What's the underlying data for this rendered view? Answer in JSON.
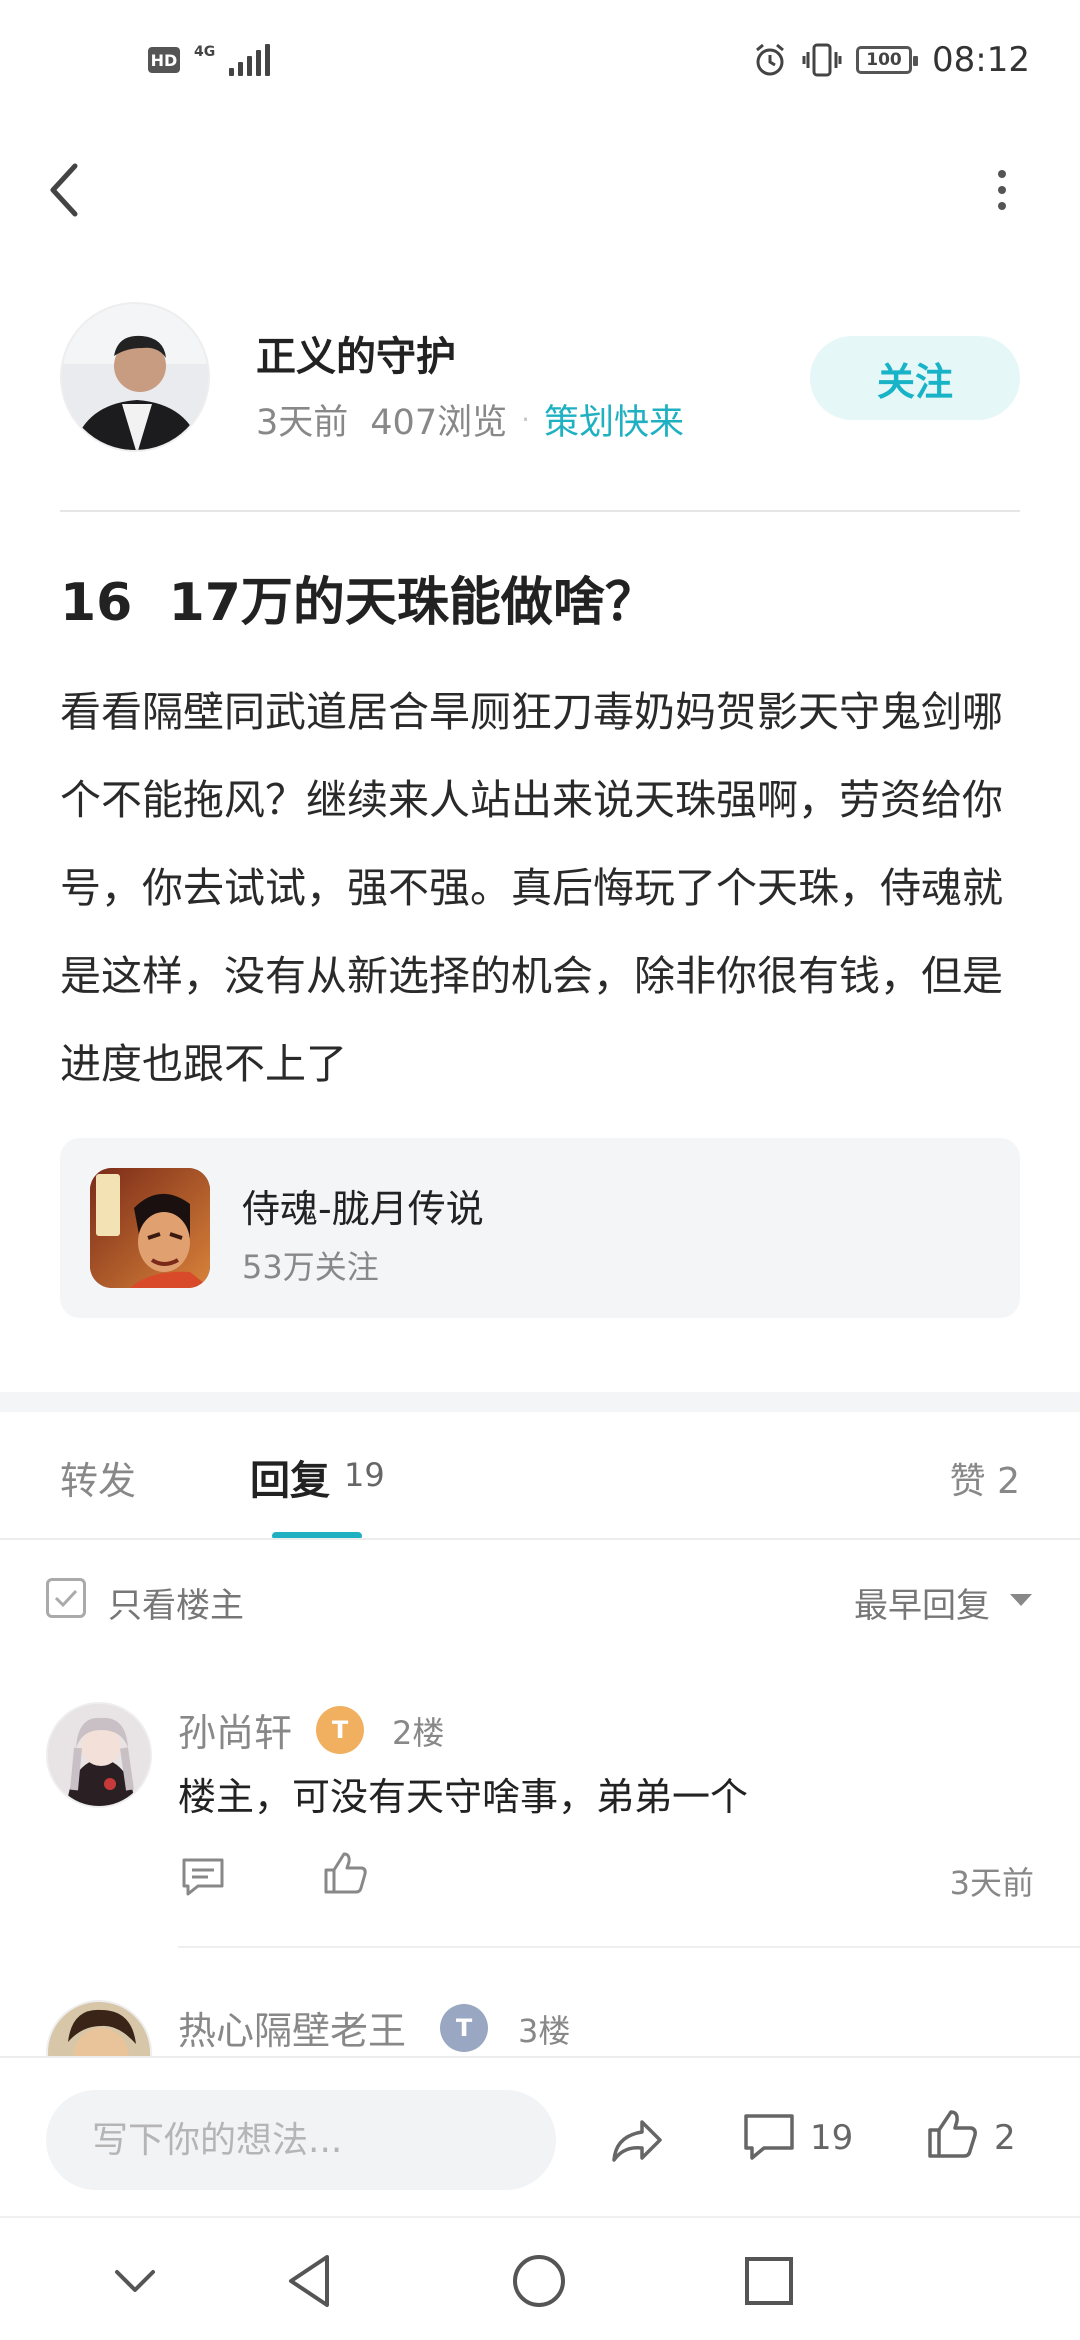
{
  "status_bar": {
    "hd": "HD",
    "network": "4G",
    "battery": "100",
    "time": "08:12"
  },
  "nav": {
    "back_icon": "chevron-left-icon",
    "more_icon": "more-vertical-icon"
  },
  "author": {
    "name": "正义的守护",
    "time_ago": "3天前",
    "views": "407浏览",
    "separator": "·",
    "category": "策划快来",
    "follow_label": "关注"
  },
  "post": {
    "title": "16  17万的天珠能做啥？",
    "body": "看看隔壁同武道居合旱厕狂刀毒奶妈贺影天守鬼剑哪个不能拖风？继续来人站出来说天珠强啊，劳资给你号，你去试试，强不强。真后悔玩了个天珠，侍魂就是这样，没有从新选择的机会，除非你很有钱，但是进度也跟不上了"
  },
  "game": {
    "name": "侍魂-胧月传说",
    "followers": "53万关注"
  },
  "tabs": {
    "repost": "转发",
    "reply": "回复",
    "reply_count": "19",
    "like": "赞 2"
  },
  "filter": {
    "only_op": "只看楼主",
    "sort": "最早回复"
  },
  "comments": [
    {
      "name": "孙尚轩",
      "floor": "2楼",
      "text": "楼主，可没有天守啥事，弟弟一个",
      "time": "3天前",
      "level_color": "#f0b060"
    },
    {
      "name": "热心隔壁老王",
      "floor": "3楼",
      "text": "",
      "time": "",
      "level_color": "#9aa7c2"
    }
  ],
  "bottom_bar": {
    "input_placeholder": "写下你的想法...",
    "comment_count": "19",
    "like_count": "2"
  },
  "colors": {
    "accent": "#1fb0c2",
    "follow_bg": "#e6f7f8"
  }
}
